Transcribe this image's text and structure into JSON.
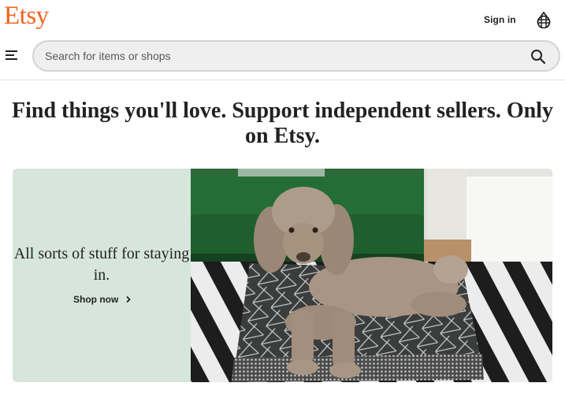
{
  "header": {
    "logo": "Etsy",
    "sign_in": "Sign in",
    "basket_icon": "basket-icon",
    "menu_icon": "hamburger-menu-icon"
  },
  "search": {
    "placeholder": "Search for items or shops",
    "value": "",
    "icon": "search-icon"
  },
  "headline": "Find things you'll love. Support independent sellers. Only on Etsy.",
  "hero": {
    "title": "All sorts of stuff for staying in.",
    "cta": "Shop now",
    "cta_icon": "chevron-right-icon",
    "image": "poodle-on-geometric-cushion-photo"
  },
  "colors": {
    "brand": "#F1641E",
    "hero_panel": "#d7e6dc",
    "text": "#222222",
    "search_bg": "#efefef"
  }
}
